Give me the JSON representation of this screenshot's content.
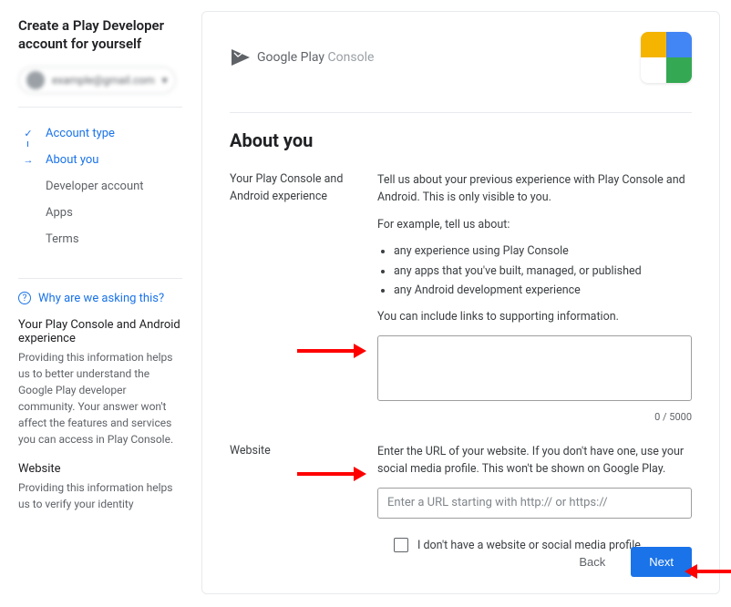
{
  "sidebar": {
    "title": "Create a Play Developer account for yourself",
    "account_email": "example@gmail.com",
    "steps": [
      {
        "label": "Account type",
        "state": "done"
      },
      {
        "label": "About you",
        "state": "current"
      },
      {
        "label": "Developer account",
        "state": "future"
      },
      {
        "label": "Apps",
        "state": "future"
      },
      {
        "label": "Terms",
        "state": "future"
      }
    ],
    "help_link": "Why are we asking this?",
    "help_sections": [
      {
        "heading": "Your Play Console and Android experience",
        "body": "Providing this information helps us to better understand the Google Play developer community. Your answer won't affect the features and services you can access in Play Console."
      },
      {
        "heading": "Website",
        "body": "Providing this information helps us to verify your identity"
      }
    ]
  },
  "main": {
    "logo_gp": "Google Play",
    "logo_console": "Console",
    "page_title": "About you",
    "experience": {
      "label": "Your Play Console and Android experience",
      "intro": "Tell us about your previous experience with Play Console and Android. This is only visible to you.",
      "example_lead": "For example, tell us about:",
      "bullets": [
        "any experience using Play Console",
        "any apps that you've built, managed, or published",
        "any Android development experience"
      ],
      "outro": "You can include links to supporting information.",
      "textarea_value": "",
      "counter": "0 / 5000"
    },
    "website": {
      "label": "Website",
      "desc": "Enter the URL of your website. If you don't have one, use your social media profile. This won't be shown on Google Play.",
      "placeholder": "Enter a URL starting with http:// or https://",
      "checkbox_label": "I don't have a website or social media profile"
    },
    "footer": {
      "back": "Back",
      "next": "Next"
    }
  }
}
